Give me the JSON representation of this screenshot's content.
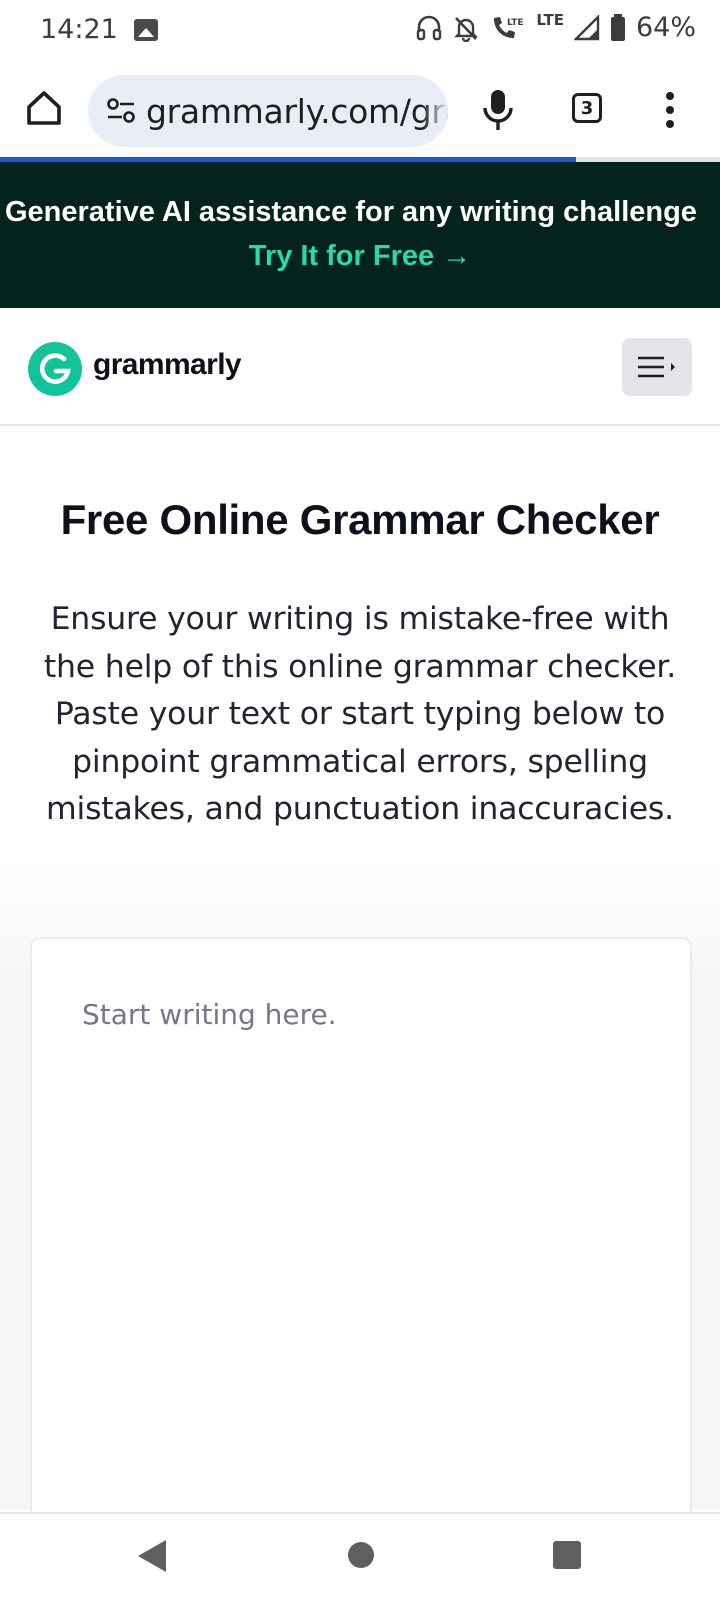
{
  "status_bar": {
    "time": "14:21",
    "battery_percent": "64%",
    "network_label": "LTE",
    "icons": [
      "gallery-icon",
      "headphones-icon",
      "notifications-off-icon",
      "wifi-calling-icon",
      "signal-icon",
      "battery-icon"
    ]
  },
  "browser": {
    "url": "grammarly.com/grammar-check",
    "tab_count": "3",
    "page_load_progress": 0.8,
    "icons": [
      "home-icon",
      "site-settings-icon",
      "microphone-icon",
      "tabs-icon",
      "more-vert-icon"
    ]
  },
  "promo_banner": {
    "text": "Generative AI assistance for any writing challenge",
    "cta_label": "Try It for Free",
    "cta_arrow": "→",
    "background": "#04231c",
    "cta_color": "#2cd9a5"
  },
  "header": {
    "logo_text": "grammarly",
    "brand_color": "#15c39a",
    "menu_icon": "hamburger-menu-icon"
  },
  "main": {
    "title": "Free Online Grammar Checker",
    "description": "Ensure your writing is mistake-free with the help of this online grammar checker. Paste your text or start typing below to pinpoint grammatical errors, spelling mistakes, and punctuation inaccuracies.",
    "editor_placeholder": "Start writing here."
  },
  "nav_bar": {
    "icons": [
      "back-icon",
      "home-circle-icon",
      "recents-icon"
    ]
  }
}
